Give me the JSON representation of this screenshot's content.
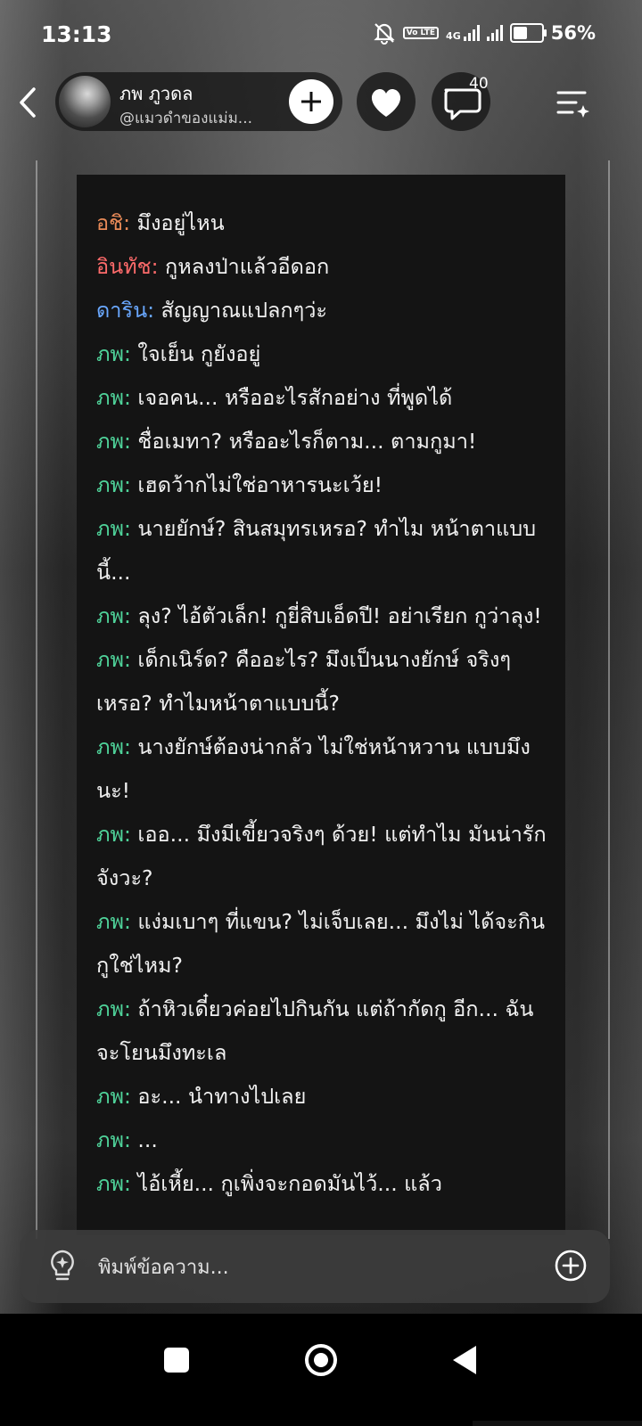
{
  "status_bar": {
    "time": "13:13",
    "network": "4G",
    "volte": "Vo LTE",
    "battery_percent": "56%",
    "battery_level": 0.56
  },
  "header": {
    "profile_name": "ภพ ภูวดล",
    "profile_handle": "@แมวดำของแม่ม...",
    "comment_count": "40"
  },
  "colors": {
    "name_orange": "#e88a58",
    "name_red": "#ff6b6b",
    "name_blue": "#6aa8ff",
    "name_green": "#4fd39a",
    "panel_bg": "#141414"
  },
  "chat": {
    "messages": [
      {
        "speaker": "อชิ:",
        "color": "#e88a58",
        "text": " มึงอยู่ไหน"
      },
      {
        "speaker": "อินทัช:",
        "color": "#ff6b6b",
        "text": " กูหลงป่าแล้วอีดอก"
      },
      {
        "speaker": "ดาริน:",
        "color": "#6aa8ff",
        "text": " สัญญาณแปลกๆว่ะ"
      },
      {
        "speaker": "ภพ:",
        "color": "#4fd39a",
        "text": " ใจเย็น กูยังอยู่"
      },
      {
        "speaker": "ภพ:",
        "color": "#4fd39a",
        "text": " เจอคน... หรืออะไรสักอย่าง ที่พูดได้"
      },
      {
        "speaker": "ภพ:",
        "color": "#4fd39a",
        "text": " ชื่อเมทา? หรืออะไรก็ตาม... ตามกูมา!"
      },
      {
        "speaker": "ภพ:",
        "color": "#4fd39a",
        "text": " เฮดว้ากไม่ใช่อาหารนะเว้ย!"
      },
      {
        "speaker": "ภพ:",
        "color": "#4fd39a",
        "text": " นายยักษ์? สินสมุทรเหรอ? ทำไม หน้าตาแบบนี้..."
      },
      {
        "speaker": "ภพ:",
        "color": "#4fd39a",
        "text": " ลุง? ไอ้ตัวเล็ก! กูยี่สิบเอ็ดปี! อย่าเรียก กูว่าลุง!"
      },
      {
        "speaker": "ภพ:",
        "color": "#4fd39a",
        "text": " เด็กเนิร์ด? คืออะไร? มึงเป็นนางยักษ์ จริงๆ เหรอ? ทำไมหน้าตาแบบนี้?"
      },
      {
        "speaker": "ภพ:",
        "color": "#4fd39a",
        "text": " นางยักษ์ต้องน่ากลัว ไม่ใช่หน้าหวาน แบบมึงนะ!"
      },
      {
        "speaker": "ภพ:",
        "color": "#4fd39a",
        "text": " เออ... มึงมีเขี้ยวจริงๆ ด้วย! แต่ทำไม มันน่ารักจังวะ?"
      },
      {
        "speaker": "ภพ:",
        "color": "#4fd39a",
        "text": " แง่มเบาๆ ที่แขน? ไม่เจ็บเลย... มึงไม่ ได้จะกินกูใช่ไหม?"
      },
      {
        "speaker": "ภพ:",
        "color": "#4fd39a",
        "text": " ถ้าหิวเดี๋ยวค่อยไปกินกัน แต่ถ้ากัดกู อีก... ฉันจะโยนมึงทะเล"
      },
      {
        "speaker": "ภพ:",
        "color": "#4fd39a",
        "text": " อะ... นำทางไปเลย"
      },
      {
        "speaker": "ภพ:",
        "color": "#4fd39a",
        "text": " ..."
      },
      {
        "speaker": "ภพ:",
        "color": "#4fd39a",
        "text": " ไอ้เหี้ย... กูเพิ่งจะกอดมันไว้... แล้ว"
      }
    ]
  },
  "input": {
    "placeholder": "พิมพ์ข้อความ..."
  },
  "icons": {
    "back": "chevron-left-icon",
    "add": "plus-icon",
    "like": "heart-icon",
    "comment": "comment-bubble-icon",
    "menu": "menu-sparkle-icon",
    "hint": "lightbulb-icon",
    "attach": "plus-circle-icon"
  }
}
